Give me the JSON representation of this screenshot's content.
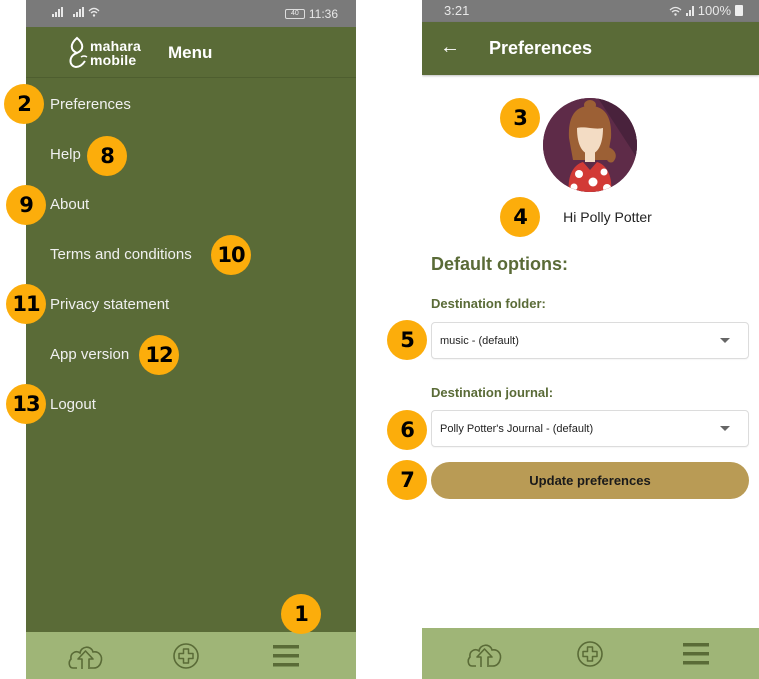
{
  "left_screen": {
    "status_bar": {
      "time": "11:36",
      "battery": "40"
    },
    "app_logo": {
      "line1": "mahara",
      "line2": "mobile"
    },
    "header_title": "Menu",
    "menu_items": [
      {
        "label": "Preferences"
      },
      {
        "label": "Help"
      },
      {
        "label": "About"
      },
      {
        "label": "Terms and conditions"
      },
      {
        "label": "Privacy statement"
      },
      {
        "label": "App version"
      },
      {
        "label": "Logout"
      }
    ],
    "bottom_nav": [
      {
        "icon": "cloud-upload-icon"
      },
      {
        "icon": "add-circle-icon"
      },
      {
        "icon": "hamburger-menu-icon"
      }
    ]
  },
  "right_screen": {
    "status_bar": {
      "time": "3:21",
      "battery": "100%"
    },
    "header": {
      "back_icon": "←",
      "title": "Preferences"
    },
    "greeting": "Hi Polly Potter",
    "section_title": "Default options:",
    "destination_folder": {
      "label": "Destination folder:",
      "value": "music - (default)"
    },
    "destination_journal": {
      "label": "Destination journal:",
      "value": "Polly Potter's Journal - (default)"
    },
    "update_button": "Update preferences",
    "bottom_nav": [
      {
        "icon": "cloud-upload-icon"
      },
      {
        "icon": "add-circle-icon"
      },
      {
        "icon": "hamburger-menu-icon"
      }
    ]
  },
  "callouts": [
    "1",
    "2",
    "3",
    "4",
    "5",
    "6",
    "7",
    "8",
    "9",
    "10",
    "11",
    "12",
    "13"
  ],
  "colors": {
    "header_green": "#5a6b37",
    "nav_green": "#9fb577",
    "button_gold": "#b99b55",
    "callout_orange": "#fcad0b",
    "label_green": "#5a6b37"
  }
}
